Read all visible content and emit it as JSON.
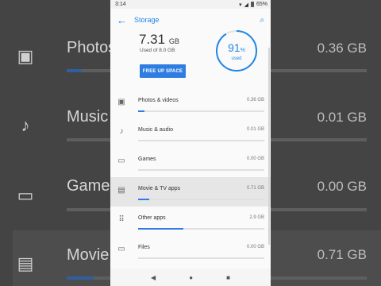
{
  "status_bar": {
    "time": "3:14",
    "battery": "65%"
  },
  "app_bar": {
    "title": "Storage"
  },
  "summary": {
    "used_value": "7.31",
    "used_unit": "GB",
    "used_of": "Used of 8.0 GB",
    "free_up_label": "FREE UP SPACE",
    "percent_value": "91",
    "percent_symbol": "%",
    "percent_caption": "used",
    "percent_fraction": 0.91
  },
  "categories": [
    {
      "label": "Photos & videos",
      "value": "0.36 GB",
      "fraction": 0.05,
      "icon": "photo-icon"
    },
    {
      "label": "Music & audio",
      "value": "0.01 GB",
      "fraction": 0.0,
      "icon": "music-note-icon"
    },
    {
      "label": "Games",
      "value": "0.00 GB",
      "fraction": 0.0,
      "icon": "gamepad-icon"
    },
    {
      "label": "Movie & TV apps",
      "value": "0.71 GB",
      "fraction": 0.09,
      "icon": "movie-icon"
    },
    {
      "label": "Other apps",
      "value": "2.9 GB",
      "fraction": 0.36,
      "icon": "apps-grid-icon"
    },
    {
      "label": "Files",
      "value": "0.00 GB",
      "fraction": 0.0,
      "icon": "folder-icon"
    }
  ],
  "background": {
    "rows": [
      {
        "label": "Photos",
        "value": "0.36 GB",
        "icon": "photo-icon"
      },
      {
        "label": "Music",
        "value": "0.01 GB",
        "icon": "music-note-icon"
      },
      {
        "label": "Games",
        "value": "0.00 GB",
        "icon": "gamepad-icon"
      },
      {
        "label": "Movie",
        "value": "0.71 GB",
        "icon": "movie-icon"
      }
    ]
  },
  "colors": {
    "accent": "#1e88e5",
    "button": "#2f7de1"
  }
}
